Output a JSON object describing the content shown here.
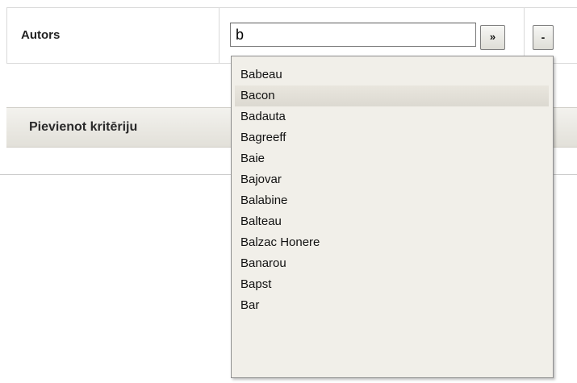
{
  "criterion": {
    "label": "Autors",
    "input_value": "b",
    "search_button_label": "»",
    "remove_button_label": "-"
  },
  "add_criterion": {
    "label": "Pievienot kritēriju"
  },
  "suggestions": {
    "highlighted_index": 1,
    "items": [
      "Babeau",
      "Bacon",
      "Badauta",
      "Bagreeff",
      "Baie",
      "Bajovar",
      "Balabine",
      "Balteau",
      "Balzac Honere",
      "Banarou",
      "Bapst",
      "Bar"
    ]
  }
}
